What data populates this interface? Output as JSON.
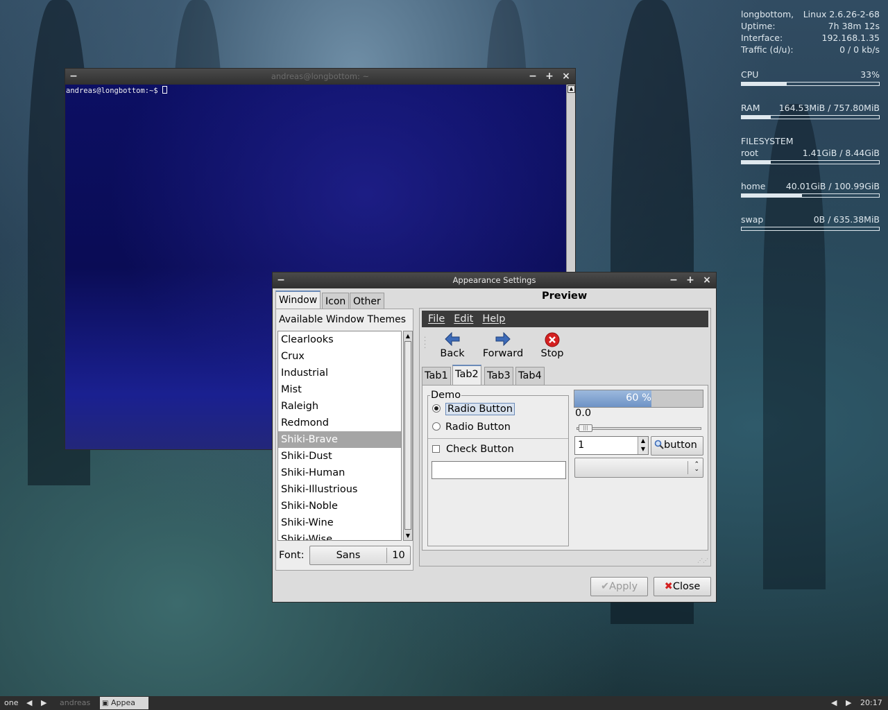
{
  "conky": {
    "host_label": "longbottom,",
    "kernel": "Linux 2.6.26-2-68",
    "uptime_label": "Uptime:",
    "uptime": "7h 38m 12s",
    "interface_label": "Interface:",
    "interface": "192.168.1.35",
    "traffic_label": "Traffic (d/u):",
    "traffic": "0 / 0 kb/s",
    "cpu_label": "CPU",
    "cpu_value": "33%",
    "cpu_fraction": 0.33,
    "ram_label": "RAM",
    "ram_value": "164.53MiB / 757.80MiB",
    "ram_fraction": 0.21,
    "fs_heading": "FILESYSTEM",
    "root_label": "root",
    "root_value": "1.41GiB / 8.44GiB",
    "root_fraction": 0.21,
    "home_label": "home",
    "home_value": "40.01GiB / 100.99GiB",
    "home_fraction": 0.44,
    "swap_label": "swap",
    "swap_value": "0B / 635.38MiB",
    "swap_fraction": 0.0
  },
  "terminal": {
    "title": "andreas@longbottom: ~",
    "prompt": "andreas@longbottom:~$ "
  },
  "appearance": {
    "title": "Appearance Settings",
    "tabs": [
      "Window",
      "Icon",
      "Other"
    ],
    "themes_heading": "Available Window Themes",
    "themes": [
      "Clearlooks",
      "Crux",
      "Industrial",
      "Mist",
      "Raleigh",
      "Redmond",
      "Shiki-Brave",
      "Shiki-Dust",
      "Shiki-Human",
      "Shiki-Illustrious",
      "Shiki-Noble",
      "Shiki-Wine",
      "Shiki-Wise"
    ],
    "selected_theme": "Shiki-Brave",
    "font_label": "Font:",
    "font_name": "Sans",
    "font_size": "10",
    "preview": {
      "title": "Preview",
      "menu": [
        "File",
        "Edit",
        "Help"
      ],
      "toolbar": {
        "back": "Back",
        "forward": "Forward",
        "stop": "Stop"
      },
      "tabs": [
        "Tab1",
        "Tab2",
        "Tab3",
        "Tab4"
      ],
      "active_tab": "Tab2",
      "demo_label": "Demo",
      "radio1": "Radio Button",
      "radio2": "Radio Button",
      "check": "Check Button",
      "progress_text": "60 %",
      "progress_fraction": 0.6,
      "scale_value": "0.0",
      "spin_value": "1",
      "icon_button": "button"
    },
    "apply": "Apply",
    "close": "Close"
  },
  "taskbar": {
    "workspace": "one",
    "task_terminal": "andreas",
    "task_appearance": "Appea",
    "clock": "20:17"
  },
  "colors": {
    "progress": "#6e93c6",
    "selection": "#a5a5a5",
    "stop": "#d42020",
    "arrows": "#3d6bb8"
  }
}
